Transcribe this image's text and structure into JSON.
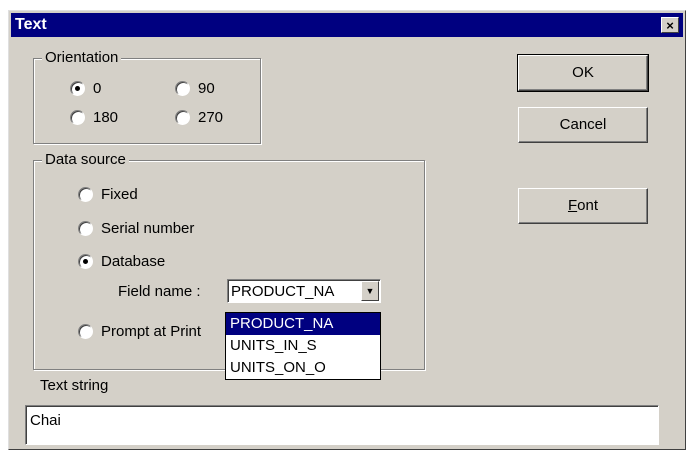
{
  "window": {
    "title": "Text",
    "close_symbol": "×"
  },
  "orientation": {
    "title": "Orientation",
    "options": [
      "0",
      "90",
      "180",
      "270"
    ],
    "selected": "0"
  },
  "data_source": {
    "title": "Data source",
    "options": [
      "Fixed",
      "Serial number",
      "Database",
      "Prompt at Print"
    ],
    "selected": "Database",
    "field_name_label": "Field name :",
    "field_value": "PRODUCT_NA",
    "dropdown_items": [
      "PRODUCT_NA",
      "UNITS_IN_S",
      "UNITS_ON_O"
    ],
    "dropdown_selected": "PRODUCT_NA"
  },
  "buttons": {
    "ok": "OK",
    "cancel": "Cancel",
    "font_rest": "ont",
    "font_accel": "F"
  },
  "text_string": {
    "label": "Text string",
    "value": "Chai"
  },
  "icons": {
    "combo_arrow": "down-triangle-icon",
    "close": "close-icon"
  }
}
